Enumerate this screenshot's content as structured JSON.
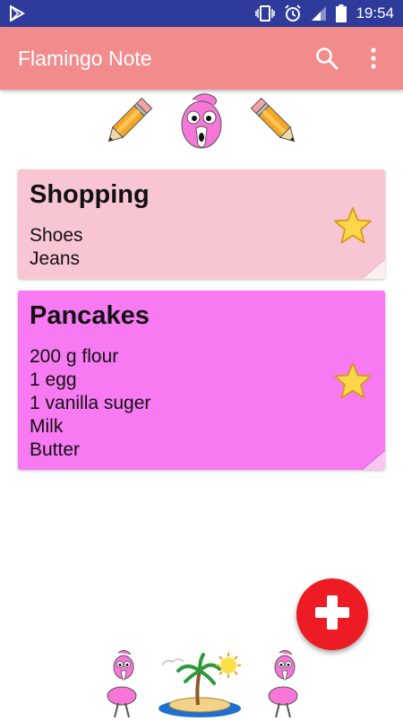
{
  "status_bar": {
    "time": "19:54",
    "icons": [
      "play-store-icon",
      "vibrate-icon",
      "alarm-icon",
      "signal-icon",
      "battery-icon"
    ]
  },
  "app_bar": {
    "title": "Flamingo Note",
    "actions": [
      "search-icon",
      "overflow-menu-icon"
    ]
  },
  "notes": [
    {
      "title": "Shopping",
      "lines": [
        "Shoes",
        "Jeans"
      ],
      "color": "#f8c6d3",
      "starred": true
    },
    {
      "title": "Pancakes",
      "lines": [
        "200 g flour",
        "1 egg",
        "1 vanilla suger",
        "Milk",
        "Butter"
      ],
      "color": "#f77af2",
      "starred": true
    }
  ],
  "fab": {
    "icon": "plus-icon",
    "color": "#ed1c24"
  },
  "colors": {
    "status_bar": "#2f3b9a",
    "app_bar": "#f28c8c",
    "fab": "#ed1c24"
  }
}
